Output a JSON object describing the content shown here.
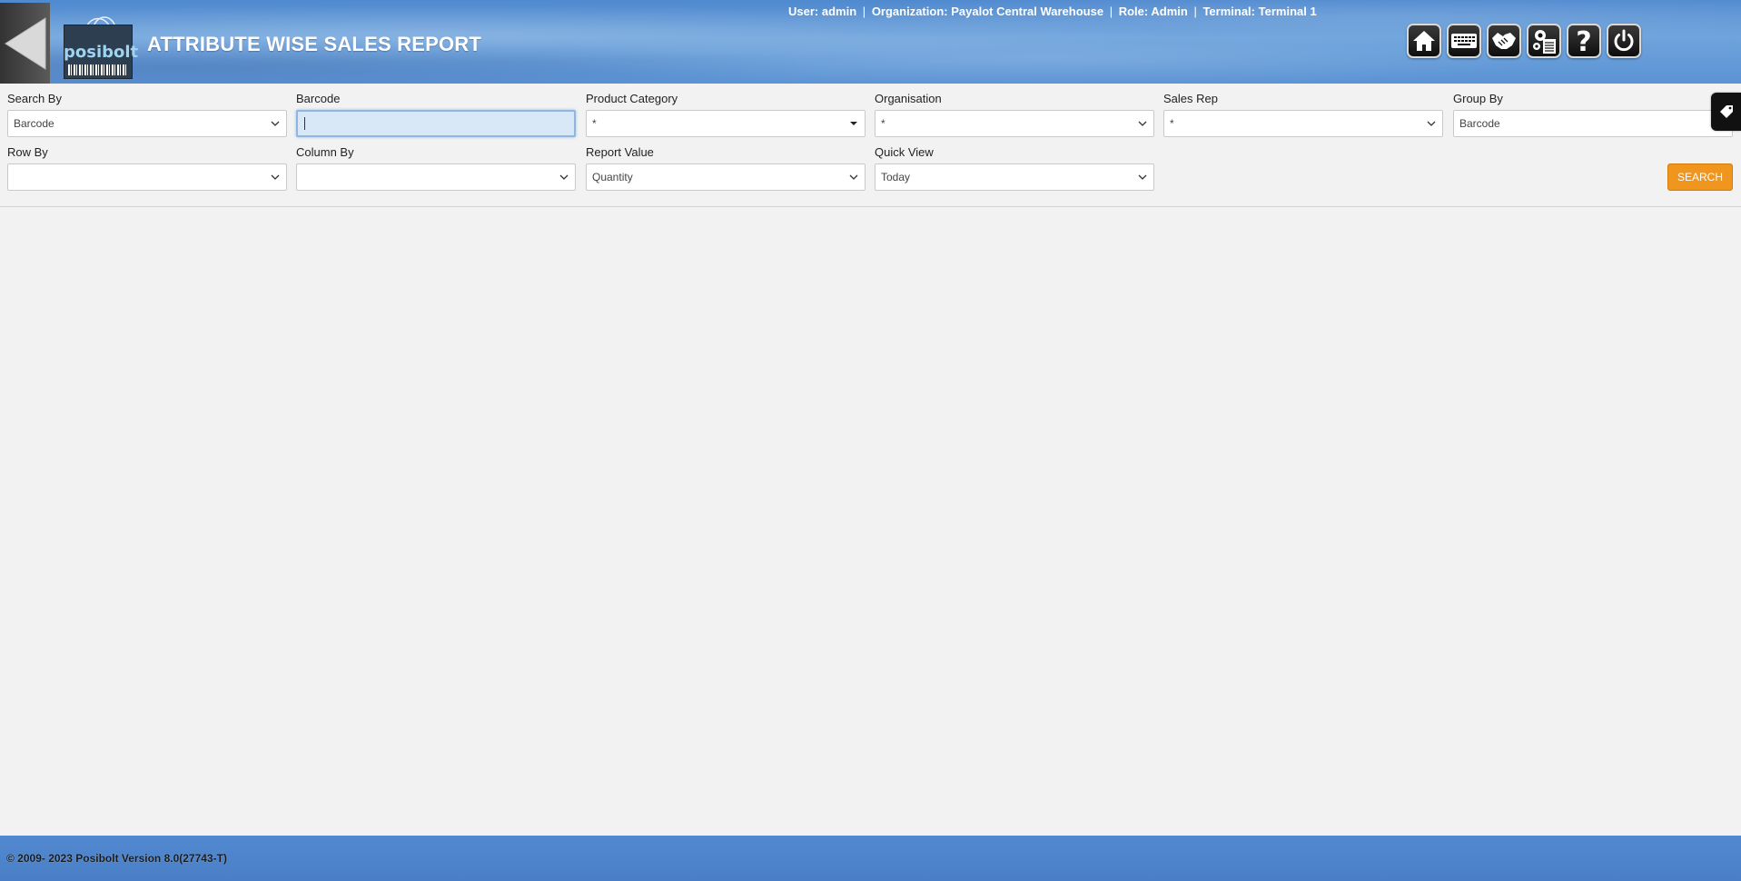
{
  "header": {
    "title": "ATTRIBUTE WISE SALES REPORT",
    "logo_text": "posibolt",
    "user_label": "User:",
    "user": "admin",
    "org_label": "Organization:",
    "organization": "Payalot Central Warehouse",
    "role_label": "Role:",
    "role": "Admin",
    "terminal_label": "Terminal:",
    "terminal": "Terminal 1",
    "separator": "|",
    "toolbar_icons": [
      "home-icon",
      "keyboard-icon",
      "handshake-icon",
      "settings-report-icon",
      "help-icon",
      "power-icon"
    ]
  },
  "filters": {
    "search_by": {
      "label": "Search By",
      "value": "Barcode"
    },
    "barcode": {
      "label": "Barcode",
      "value": ""
    },
    "product_category": {
      "label": "Product Category",
      "value": "*"
    },
    "organisation": {
      "label": "Organisation",
      "value": "*"
    },
    "sales_rep": {
      "label": "Sales Rep",
      "value": "*"
    },
    "group_by": {
      "label": "Group By",
      "value": "Barcode"
    },
    "row_by": {
      "label": "Row By",
      "value": ""
    },
    "column_by": {
      "label": "Column By",
      "value": ""
    },
    "report_value": {
      "label": "Report Value",
      "value": "Quantity"
    },
    "quick_view": {
      "label": "Quick View",
      "value": "Today"
    },
    "search_label": "SEARCH"
  },
  "footer": {
    "text": "© 2009- 2023 Posibolt Version  8.0(27743-T)"
  },
  "colors": {
    "header_blue": "#5b93d4",
    "accent_orange": "#f0961e",
    "footer_blue": "#4a7fc6"
  }
}
